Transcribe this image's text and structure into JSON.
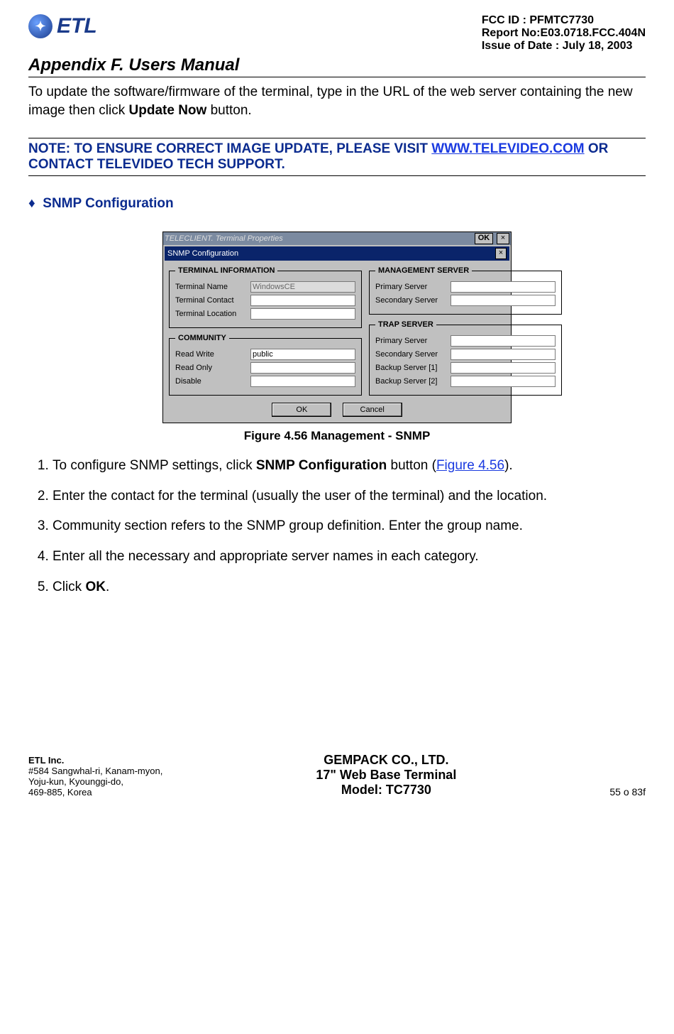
{
  "header": {
    "logo_text": "ETL",
    "meta": {
      "fcc": "FCC ID : PFMTC7730",
      "report": "Report No:E03.0718.FCC.404N",
      "date": "Issue of Date : July 18, 2003"
    },
    "appendix_title": "Appendix F.  Users Manual"
  },
  "intro": {
    "line1_pre": "To update the software/firmware of the terminal, type in the URL of the web server containing the new image then click ",
    "bold": "Update Now",
    "line1_post": " button."
  },
  "note": {
    "pre": "NOTE: TO ENSURE CORRECT IMAGE UPDATE, PLEASE VISIT ",
    "link": "WWW.TELEVIDEO.COM",
    "post": " OR CONTACT TELEVIDEO TECH SUPPORT."
  },
  "section_title": "SNMP Configuration",
  "dialog": {
    "outer_title": "TELECLIENT. Terminal Properties",
    "outer_ok": "OK",
    "title": "SNMP Configuration",
    "groups": {
      "terminal_info": {
        "legend": "TERMINAL INFORMATION",
        "terminal_name_label": "Terminal Name",
        "terminal_name_value": "WindowsCE",
        "terminal_contact_label": "Terminal Contact",
        "terminal_location_label": "Terminal Location"
      },
      "community": {
        "legend": "COMMUNITY",
        "read_write_label": "Read Write",
        "read_write_value": "public",
        "read_only_label": "Read Only",
        "disable_label": "Disable"
      },
      "mgmt_server": {
        "legend": "MANAGEMENT SERVER",
        "primary_label": "Primary Server",
        "secondary_label": "Secondary Server"
      },
      "trap_server": {
        "legend": "TRAP SERVER",
        "primary_label": "Primary Server",
        "secondary_label": "Secondary Server",
        "backup1_label": "Backup Server [1]",
        "backup2_label": "Backup Server [2]"
      }
    },
    "ok": "OK",
    "cancel": "Cancel"
  },
  "figure_caption": "Figure 4.56       Management - SNMP",
  "steps": {
    "s1_pre": "To configure SNMP settings, click ",
    "s1_bold": "SNMP Configuration",
    "s1_mid": " button (",
    "s1_link": "Figure 4.56",
    "s1_post": ").",
    "s2": "Enter the contact for the terminal (usually the user of the terminal) and the location.",
    "s3": "Community section refers to the SNMP group definition.  Enter the group name.",
    "s4": "Enter all the necessary and appropriate server names in each category.",
    "s5_pre": "Click ",
    "s5_bold": "OK",
    "s5_post": "."
  },
  "footer": {
    "left_name": "ETL Inc.",
    "left_addr1": "#584 Sangwhal-ri, Kanam-myon,",
    "left_addr2": "Yoju-kun, Kyounggi-do,",
    "left_addr3": "469-885, Korea",
    "center1": "GEMPACK CO., LTD.",
    "center2": "17\" Web Base Terminal",
    "center3": "Model: TC7730",
    "right": "55 o 83f"
  }
}
